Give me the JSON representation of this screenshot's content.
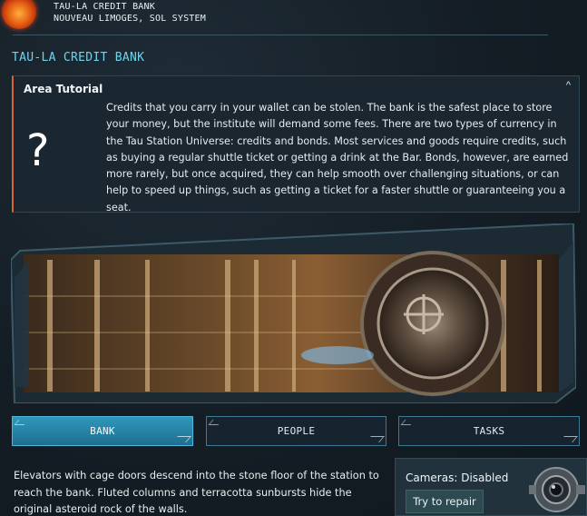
{
  "location": {
    "name": "TAU-LA CREDIT BANK",
    "subtitle": "NOUVEAU LIMOGES, SOL SYSTEM",
    "icon": "sun-icon"
  },
  "page_title": "TAU-LA CREDIT BANK",
  "tutorial": {
    "title": "Area Tutorial",
    "collapse_icon": "^",
    "question_icon": "?",
    "accent_color": "#d4643a",
    "text": "Credits that you carry in your wallet can be stolen. The bank is the safest place to store your money, but the institute will demand some fees. There are two types of currency in the Tau Station Universe: credits and bonds. Most services and goods require credits, such as buying a regular shuttle ticket or getting a drink at the Bar. Bonds, however, are earned more rarely, but once acquired, they can help smooth over challenging situations, or can help to speed up things, such as getting a ticket for a faster shuttle or guaranteeing you a seat."
  },
  "tabs": [
    {
      "label": "BANK",
      "active": true
    },
    {
      "label": "PEOPLE",
      "active": false
    },
    {
      "label": "TASKS",
      "active": false
    }
  ],
  "description": "Elevators with cage doors descend into the stone floor of the station to reach the bank. Fluted columns and terracotta sunbursts hide the original asteroid rock of the walls.",
  "camera": {
    "status": "Cameras: Disabled",
    "repair_label": "Try to repair",
    "icon": "security-camera-icon"
  },
  "colors": {
    "accent": "#6fd4ee",
    "active_tab": "#2f97bd"
  }
}
